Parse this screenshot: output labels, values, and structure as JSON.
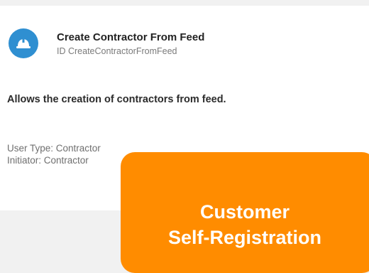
{
  "card": {
    "icon": "hard-hat-icon",
    "icon_color": "#2f8fd1",
    "title": "Create Contractor From Feed",
    "id_line": "ID CreateContractorFromFeed",
    "description": "Allows the creation of contractors from feed.",
    "user_type": "User Type: Contractor",
    "initiator": "Initiator: Contractor"
  },
  "overlay": {
    "color": "#ff8c00",
    "line1": "Customer",
    "line2": "Self-Registration"
  }
}
